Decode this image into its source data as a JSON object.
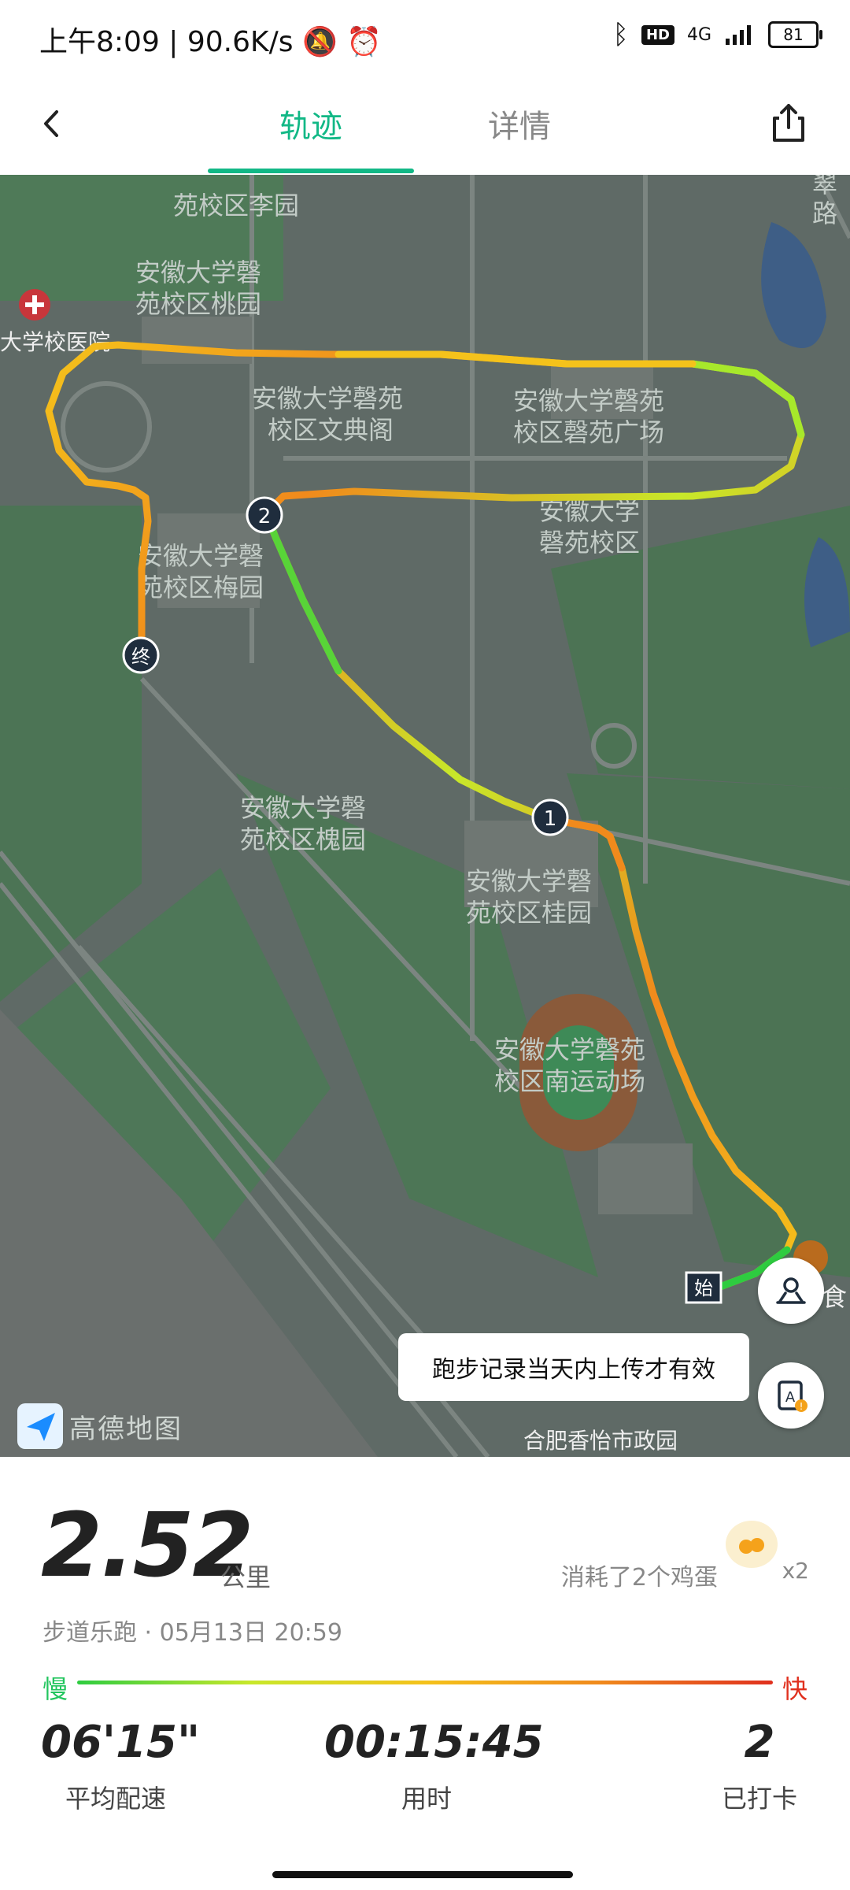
{
  "status_bar": {
    "time": "上午8:09",
    "speed": "90.6K/s",
    "network": "4G",
    "battery": "81",
    "hd": "HD"
  },
  "nav": {
    "tab_track": "轨迹",
    "tab_details": "详情"
  },
  "map": {
    "labels": [
      "苑校区李园",
      "安徽大学磬",
      "苑校区桃园",
      "大学校医院",
      "安徽大学磬苑",
      "校区文典阁",
      "安徽大学磬苑",
      "校区磬苑广场",
      "安徽大学",
      "磬苑校区",
      "安徽大学磬",
      "苑校区梅园",
      "安徽大学磬",
      "苑校区槐园",
      "安徽大学磬",
      "苑校区桂园",
      "安徽大学磬苑",
      "校区南运动场",
      "合肥香怡市政园",
      "翠",
      "路",
      "食"
    ],
    "markers": {
      "start": "始",
      "end": "终",
      "km1": "1",
      "km2": "2"
    },
    "watermark": "高德地图",
    "toast": "跑步记录当天内上传才有效"
  },
  "summary": {
    "distance": "2.52",
    "distance_unit": "公里",
    "eggs_text": "消耗了2个鸡蛋",
    "eggs_multiplier": "x2",
    "meta": "步道乐跑 · 05月13日 20:59",
    "legend_slow": "慢",
    "legend_fast": "快"
  },
  "metrics": [
    {
      "value": "06'15\"",
      "label": "平均配速"
    },
    {
      "value": "00:15:45",
      "label": "用时"
    },
    {
      "value": "2",
      "label": "已打卡"
    }
  ],
  "colors": {
    "accent": "#12b886",
    "slow": "#22c55e",
    "fast": "#e0301e"
  }
}
